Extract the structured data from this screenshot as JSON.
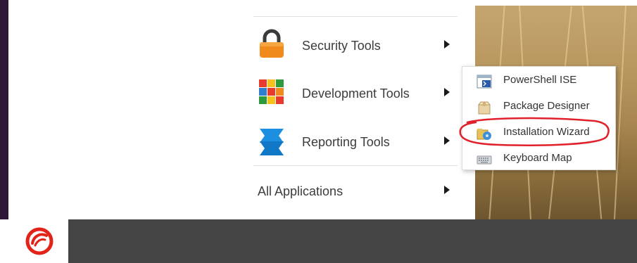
{
  "launcher": {
    "items": [
      {
        "label": "Security Tools",
        "icon": "padlock-icon"
      },
      {
        "label": "Development Tools",
        "icon": "rubiks-cube-icon"
      },
      {
        "label": "Reporting Tools",
        "icon": "blue-ribbon-icon"
      }
    ],
    "all_applications": "All Applications"
  },
  "submenu": {
    "items": [
      {
        "label": "PowerShell ISE",
        "icon": "powershell-ise-icon"
      },
      {
        "label": "Package Designer",
        "icon": "package-icon"
      },
      {
        "label": "Installation Wizard",
        "icon": "installation-wizard-icon"
      },
      {
        "label": "Keyboard Map",
        "icon": "keyboard-icon"
      }
    ]
  },
  "colors": {
    "left_bar": "#2e1838",
    "taskbar": "#454545",
    "annotation_circle": "#e0202a",
    "logo": "#e2231a"
  }
}
